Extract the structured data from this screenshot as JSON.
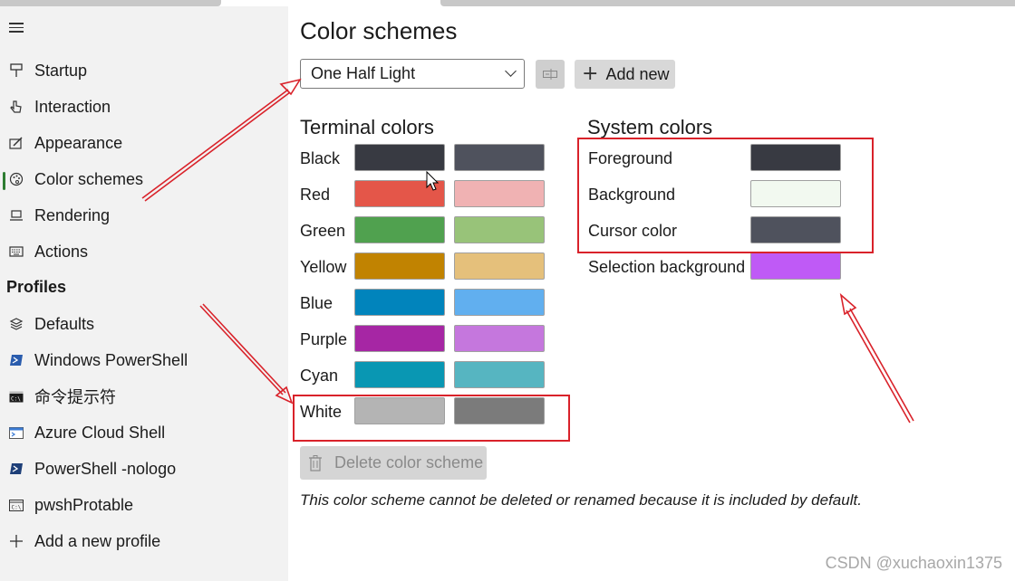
{
  "sidebar": {
    "items": [
      {
        "label": "Startup",
        "icon": "startup-icon"
      },
      {
        "label": "Interaction",
        "icon": "interaction-icon"
      },
      {
        "label": "Appearance",
        "icon": "appearance-icon"
      },
      {
        "label": "Color schemes",
        "icon": "palette-icon",
        "selected": true
      },
      {
        "label": "Rendering",
        "icon": "rendering-icon"
      },
      {
        "label": "Actions",
        "icon": "keyboard-icon"
      }
    ],
    "profiles_header": "Profiles",
    "profiles": [
      {
        "label": "Defaults",
        "icon": "layers-icon"
      },
      {
        "label": "Windows PowerShell",
        "icon": "powershell-icon"
      },
      {
        "label": "命令提示符",
        "icon": "cmd-icon"
      },
      {
        "label": "Azure Cloud Shell",
        "icon": "azure-shell-icon"
      },
      {
        "label": "PowerShell -nologo",
        "icon": "powershell-icon"
      },
      {
        "label": "pwshProtable",
        "icon": "terminal-icon"
      },
      {
        "label": "Add a new profile",
        "icon": "plus-icon"
      }
    ]
  },
  "main": {
    "title": "Color schemes",
    "scheme_select": {
      "value": "One Half Light"
    },
    "add_new_label": "Add new",
    "terminal_colors_title": "Terminal colors",
    "terminal_colors": [
      {
        "name": "Black",
        "normal": "#383a42",
        "bright": "#4f525d"
      },
      {
        "name": "Red",
        "normal": "#e45649",
        "bright": "#f0b2b3"
      },
      {
        "name": "Green",
        "normal": "#50a14f",
        "bright": "#98c379"
      },
      {
        "name": "Yellow",
        "normal": "#c18301",
        "bright": "#e5c07b"
      },
      {
        "name": "Blue",
        "normal": "#0184bc",
        "bright": "#61afef"
      },
      {
        "name": "Purple",
        "normal": "#a626a4",
        "bright": "#c577dd"
      },
      {
        "name": "Cyan",
        "normal": "#0997b3",
        "bright": "#56b5c1"
      },
      {
        "name": "White",
        "normal": "#b4b4b4",
        "bright": "#7b7b7b"
      }
    ],
    "system_colors_title": "System colors",
    "system_colors": [
      {
        "name": "Foreground",
        "color": "#383a42"
      },
      {
        "name": "Background",
        "color": "#f2f9f0"
      },
      {
        "name": "Cursor color",
        "color": "#4f525d"
      },
      {
        "name": "Selection background",
        "color": "#bf5af6"
      }
    ],
    "delete_label": "Delete color scheme",
    "note": "This color scheme cannot be deleted or renamed because it is included by default."
  },
  "watermark": "CSDN @xuchaoxin1375",
  "annotation_color": "#d9222a"
}
